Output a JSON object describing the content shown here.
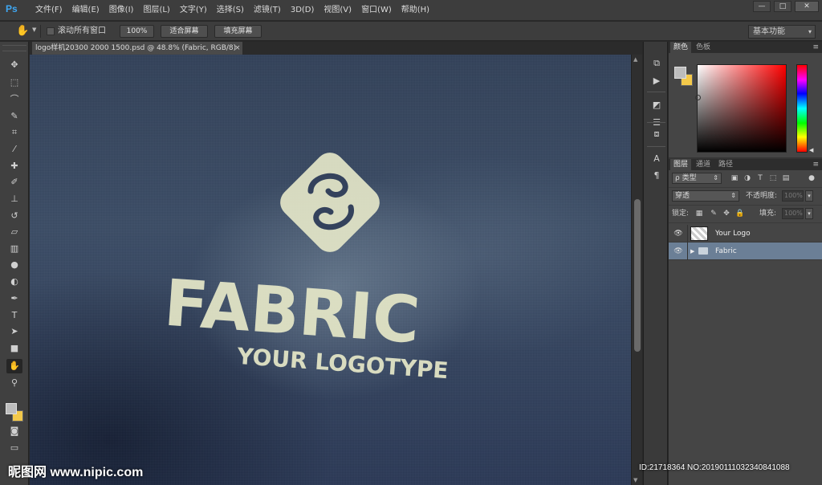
{
  "app": {
    "logo": "Ps"
  },
  "menu": [
    "文件(F)",
    "编辑(E)",
    "图像(I)",
    "图层(L)",
    "文字(Y)",
    "选择(S)",
    "滤镜(T)",
    "3D(D)",
    "视图(V)",
    "窗口(W)",
    "帮助(H)"
  ],
  "window_controls": {
    "minimize": "—",
    "maximize": "□",
    "close": "✕"
  },
  "options": {
    "tool_icon": "hand-icon",
    "scroll_all_label": "滚动所有窗口",
    "btn_100": "100%",
    "btn_fit": "适合屏幕",
    "btn_fill": "填充屏幕",
    "workspace": "基本功能"
  },
  "document": {
    "tab_title": "logo样机20300 2000 1500.psd @ 48.8% (Fabric, RGB/8)",
    "close": "×"
  },
  "canvas": {
    "headline": "FABRIC",
    "tagline": "YOUR LOGOTYPE"
  },
  "color_panel": {
    "tabs": [
      "颜色",
      "色板"
    ],
    "fg": "#bdbdbd",
    "bg": "#f4c94a"
  },
  "layers_panel": {
    "tabs": [
      "图层",
      "通道",
      "路径"
    ],
    "filter": "ρ 类型",
    "blend_mode": "穿透",
    "opacity_label": "不透明度:",
    "opacity_value": "100%",
    "lock_label": "锁定:",
    "fill_label": "填充:",
    "fill_value": "100%",
    "layers": [
      {
        "name": "Your Logo",
        "type": "smart-object",
        "visible": true
      },
      {
        "name": "Fabric",
        "type": "group",
        "visible": true,
        "selected": true
      }
    ]
  },
  "watermarks": {
    "left": "昵图网 www.nipic.com",
    "right": "ID:21718364 NO:20190111032340841088"
  },
  "colors": {
    "accent_selected": "#6b7f96",
    "ps_blue": "#3fa8f4"
  }
}
